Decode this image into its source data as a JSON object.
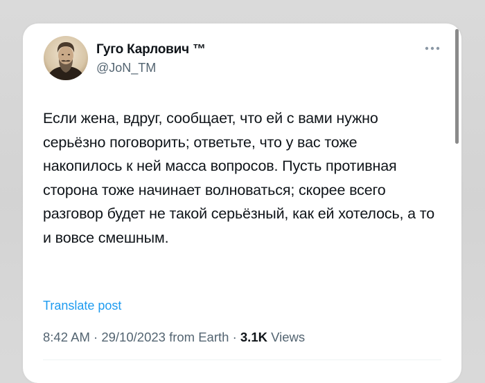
{
  "tweet": {
    "author": {
      "display_name": "Гуго Карлович ™",
      "handle": "@JoN_TM"
    },
    "text": "Если жена, вдруг, сообщает, что ей с вами нужно серьёзно поговорить; ответьте, что у вас тоже накопилось к ней масса вопросов. Пусть противная сторона тоже начинает волноваться; скорее всего разговор будет не такой серьёзный, как ей хотелось, а то и вовсе смешным.",
    "translate_label": "Translate post",
    "meta": {
      "time": "8:42 AM",
      "separator": " · ",
      "date": "29/10/2023",
      "source": "from Earth",
      "views_count": "3.1K",
      "views_label": "Views"
    }
  },
  "icons": {
    "more": "more-horizontal-icon",
    "avatar": "avatar-portrait"
  },
  "colors": {
    "text_primary": "#0f1419",
    "text_secondary": "#536471",
    "link": "#1d9bf0",
    "card_background": "#ffffff",
    "page_background": "#d9d9d9"
  }
}
